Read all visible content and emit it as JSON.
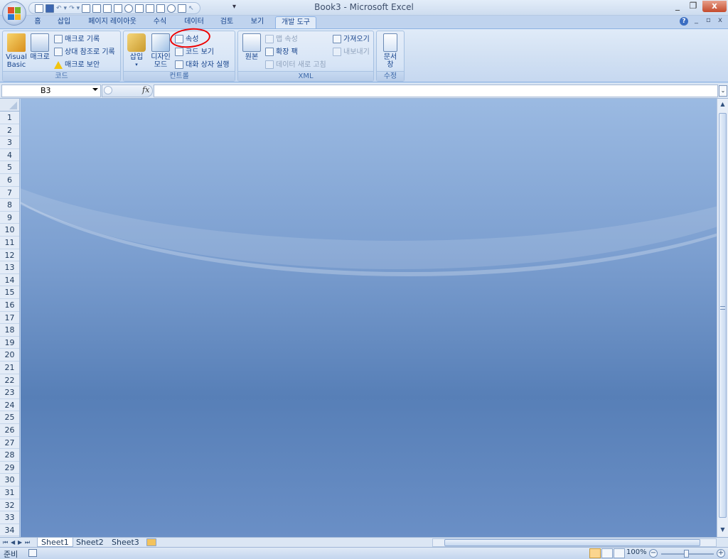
{
  "window": {
    "title": "Book3 - Microsoft Excel",
    "controls": {
      "minimize": "_",
      "restore": "❐",
      "close": "x"
    }
  },
  "quick_access": {
    "more": "▾"
  },
  "ribbon_tabs": [
    "홈",
    "삽입",
    "페이지 레이아웃",
    "수식",
    "데이터",
    "검토",
    "보기",
    "개발 도구"
  ],
  "active_tab": "개발 도구",
  "ribbon_corner": {
    "help": "?",
    "minimize": "_",
    "restore": "▫",
    "close": "x"
  },
  "groups": {
    "code": {
      "label": "코드",
      "visual_basic": "Visual Basic",
      "macro": "매크로",
      "record_macro": "매크로 기록",
      "relative_ref": "상대 참조로 기록",
      "macro_security": "매크로 보안"
    },
    "controls": {
      "label": "컨트롤",
      "insert": "삽입",
      "design_mode": "디자인 모드",
      "properties": "속성",
      "view_code": "코드 보기",
      "run_dialog": "대화 상자 실행"
    },
    "xml": {
      "label": "XML",
      "source": "원본",
      "map_properties": "맵 속성",
      "expansion_packs": "확장 팩",
      "refresh_data": "데이터 새로 고침",
      "import": "가져오기",
      "export": "내보내기"
    },
    "modify": {
      "label": "수정",
      "document_panel": "문서 창"
    }
  },
  "formula_bar": {
    "name_box": "B3",
    "fx": "fx",
    "formula": ""
  },
  "rows": [
    "1",
    "2",
    "3",
    "4",
    "5",
    "6",
    "7",
    "8",
    "9",
    "10",
    "11",
    "12",
    "13",
    "14",
    "15",
    "16",
    "17",
    "18",
    "19",
    "20",
    "21",
    "22",
    "23",
    "24",
    "25",
    "26",
    "27",
    "28",
    "29",
    "30",
    "31",
    "32",
    "33",
    "34"
  ],
  "sheets": [
    "Sheet1",
    "Sheet2",
    "Sheet3"
  ],
  "active_sheet": "Sheet1",
  "sheet_nav": [
    "⏮",
    "◀",
    "▶",
    "⏭"
  ],
  "status": {
    "ready": "준비",
    "zoom": "100%",
    "zoom_minus": "−",
    "zoom_plus": "+"
  },
  "colors": {
    "ribbon_accent": "#15428b",
    "workspace": "#5a82ba",
    "annotation": "#e00000"
  },
  "icons": {
    "visual_basic": "visual-basic-icon",
    "macro": "macro-icon",
    "record_macro": "record-macro-icon",
    "relative_ref": "relative-reference-icon",
    "macro_security": "warning-icon",
    "insert_control": "toolbox-icon",
    "design_mode": "design-ruler-icon",
    "properties": "properties-icon",
    "view_code": "view-code-icon",
    "run_dialog": "run-dialog-icon",
    "source": "xml-source-icon",
    "map_properties": "map-properties-icon",
    "expansion_packs": "expansion-packs-icon",
    "refresh_data": "refresh-data-icon",
    "import": "import-icon",
    "export": "export-icon",
    "document_panel": "document-panel-icon"
  }
}
